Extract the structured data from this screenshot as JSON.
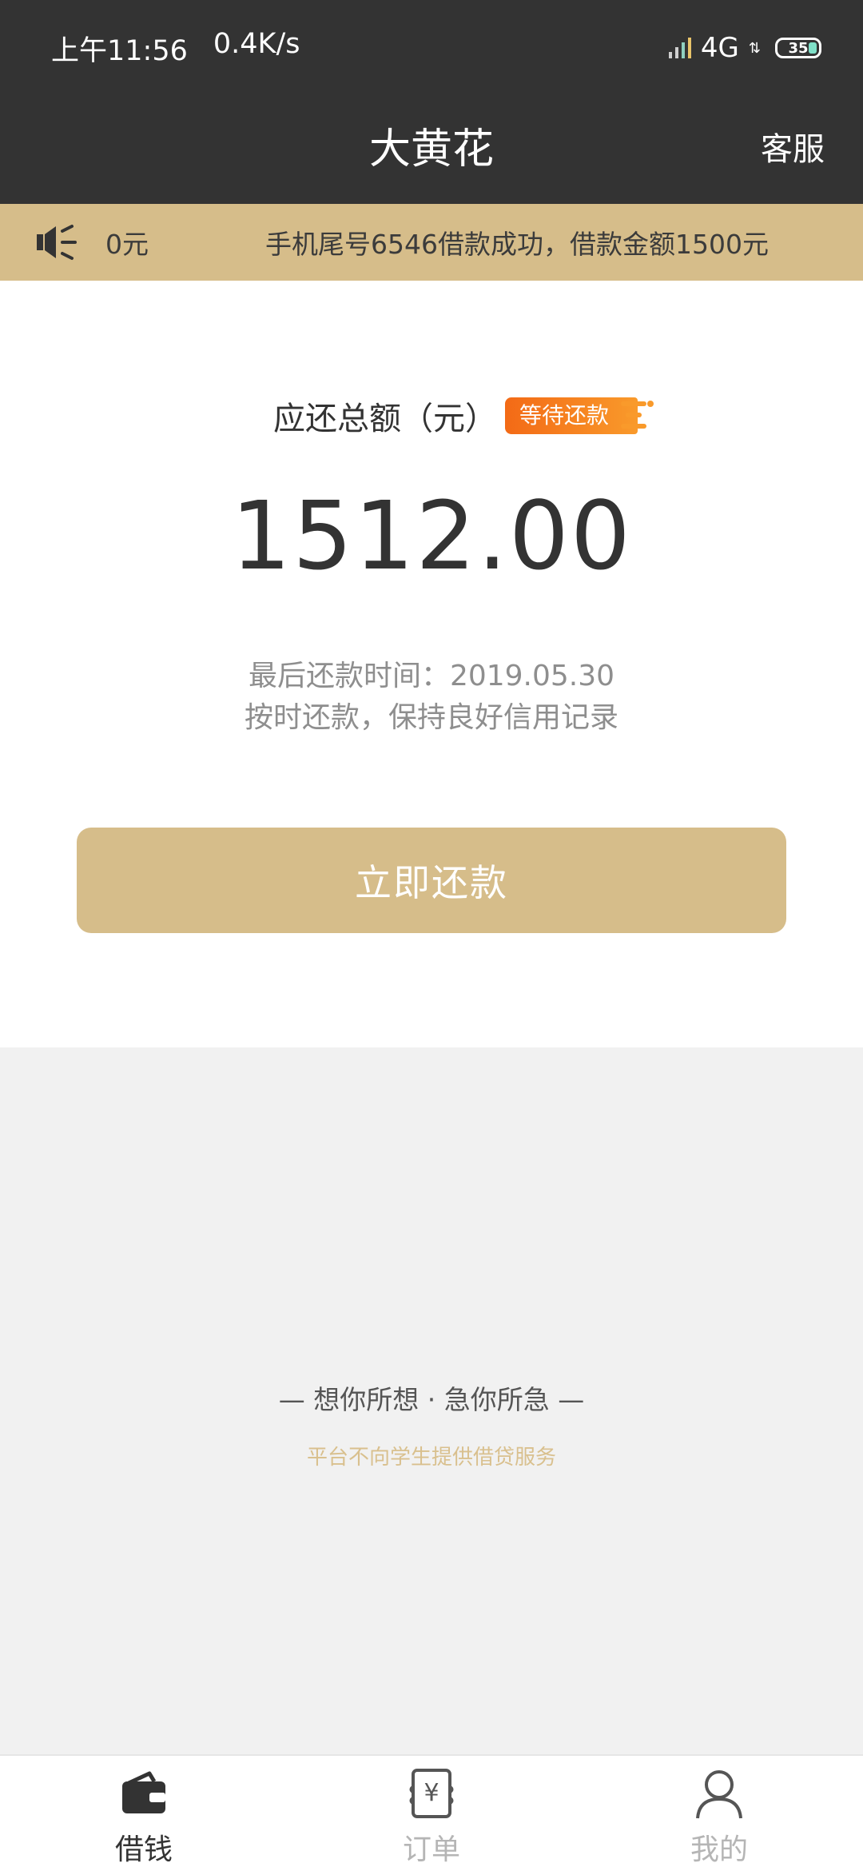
{
  "status_bar": {
    "time": "上午11:56",
    "speed": "0.4K/s",
    "network": "4G",
    "battery": "35"
  },
  "header": {
    "title": "大黄花",
    "service_label": "客服"
  },
  "notice": {
    "scrolled_fragment": "0元",
    "message": "手机尾号6546借款成功，借款金额1500元"
  },
  "repayment": {
    "label": "应还总额（元）",
    "status_badge": "等待还款",
    "amount": "1512.00",
    "due_date_text": "最后还款时间：2019.05.30",
    "hint": "按时还款，保持良好信用记录",
    "button_label": "立即还款"
  },
  "footer_info": {
    "slogan": "— 想你所想 · 急你所急 —",
    "disclaimer": "平台不向学生提供借贷服务"
  },
  "tabs": [
    {
      "label": "借钱",
      "icon": "wallet-icon",
      "active": true
    },
    {
      "label": "订单",
      "icon": "order-icon",
      "active": false
    },
    {
      "label": "我的",
      "icon": "user-icon",
      "active": false
    }
  ],
  "colors": {
    "header_bg": "#333333",
    "accent_gold": "#d6bd8a",
    "badge_orange": "#f36a16"
  }
}
